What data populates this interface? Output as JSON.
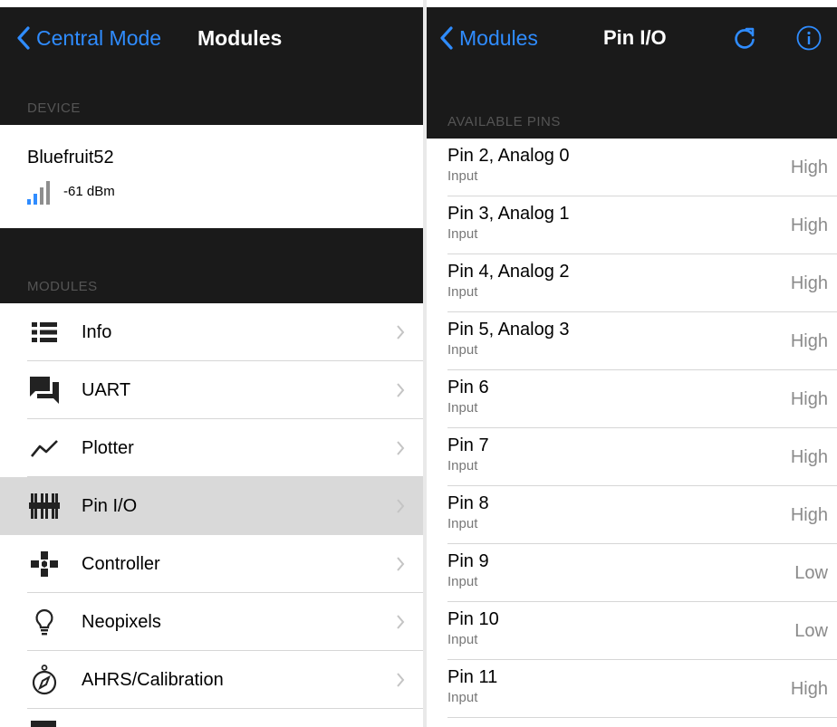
{
  "left": {
    "nav": {
      "back_label": "Central Mode",
      "title": "Modules"
    },
    "device_section": "DEVICE",
    "device": {
      "name": "Bluefruit52",
      "rssi": "-61 dBm",
      "signal_bars_active": 2,
      "signal_bars_total": 4
    },
    "modules_section": "MODULES",
    "modules": [
      {
        "label": "Info",
        "icon": "list-icon"
      },
      {
        "label": "UART",
        "icon": "chat-icon"
      },
      {
        "label": "Plotter",
        "icon": "chart-line-icon"
      },
      {
        "label": "Pin I/O",
        "icon": "pins-icon",
        "selected": true
      },
      {
        "label": "Controller",
        "icon": "dpad-icon"
      },
      {
        "label": "Neopixels",
        "icon": "lightbulb-icon"
      },
      {
        "label": "AHRS/Calibration",
        "icon": "compass-icon"
      }
    ]
  },
  "right": {
    "nav": {
      "back_label": "Modules",
      "title": "Pin I/O",
      "refresh_icon": "refresh-icon",
      "info_icon": "info-icon"
    },
    "pins_section": "AVAILABLE PINS",
    "pins": [
      {
        "name": "Pin 2, Analog 0",
        "mode": "Input",
        "value": "High"
      },
      {
        "name": "Pin 3, Analog 1",
        "mode": "Input",
        "value": "High"
      },
      {
        "name": "Pin 4, Analog 2",
        "mode": "Input",
        "value": "High"
      },
      {
        "name": "Pin 5, Analog 3",
        "mode": "Input",
        "value": "High"
      },
      {
        "name": "Pin 6",
        "mode": "Input",
        "value": "High"
      },
      {
        "name": "Pin 7",
        "mode": "Input",
        "value": "High"
      },
      {
        "name": "Pin 8",
        "mode": "Input",
        "value": "High"
      },
      {
        "name": "Pin 9",
        "mode": "Input",
        "value": "Low"
      },
      {
        "name": "Pin 10",
        "mode": "Input",
        "value": "Low"
      },
      {
        "name": "Pin 11",
        "mode": "Input",
        "value": "High"
      }
    ]
  },
  "colors": {
    "accent": "#2f8cff",
    "nav_bg": "#1a1a1a",
    "selected_row": "#d9d9d9"
  }
}
